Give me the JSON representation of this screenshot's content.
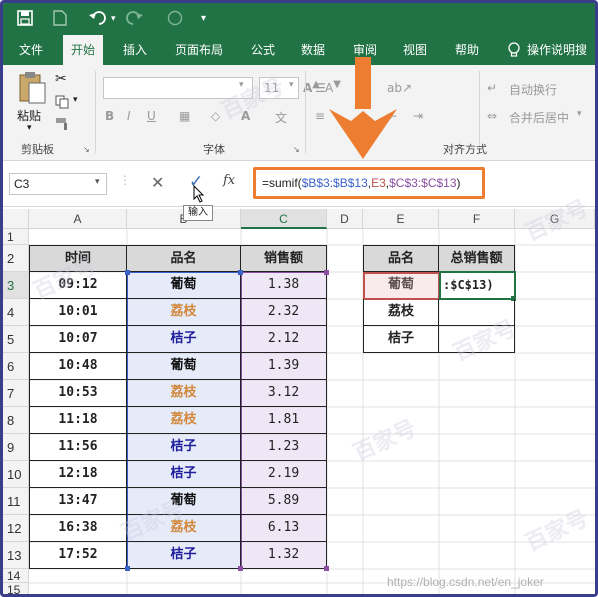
{
  "qat": {
    "save_icon": "save-icon",
    "new_icon": "new-file-icon",
    "undo_icon": "undo-icon",
    "redo_icon": "redo-icon",
    "more_icon": "customize-qat-icon"
  },
  "tabs": [
    {
      "label": "文件"
    },
    {
      "label": "开始"
    },
    {
      "label": "插入"
    },
    {
      "label": "页面布局"
    },
    {
      "label": "公式"
    },
    {
      "label": "数据"
    },
    {
      "label": "审阅"
    },
    {
      "label": "视图"
    },
    {
      "label": "帮助"
    },
    {
      "label": "操作说明搜"
    }
  ],
  "ribbon": {
    "paste_label": "粘贴",
    "clipboard_label": "剪贴板",
    "font_label": "字体",
    "font_size": "11",
    "alignment_label": "对齐方式",
    "wrap_text": "自动换行",
    "merge_center": "合并后居中"
  },
  "formula_bar": {
    "name_box": "C3",
    "cancel": "✕",
    "enter": "✓",
    "fx": "fx",
    "formula_prefix": "=sumif(",
    "formula_range1": "$B$3:$B$13",
    "formula_comma1": ",",
    "formula_crit": "E3",
    "formula_comma2": ",",
    "formula_range2": "$C$3:$C$13",
    "formula_suffix": ")",
    "enter_tooltip": "输入"
  },
  "columns": [
    "A",
    "B",
    "C",
    "D",
    "E",
    "F",
    "G"
  ],
  "rows": [
    "1",
    "2",
    "3",
    "4",
    "5",
    "6",
    "7",
    "8",
    "9",
    "10",
    "11",
    "12",
    "13",
    "14",
    "15"
  ],
  "table": {
    "headers": [
      "时间",
      "品名",
      "销售额"
    ],
    "rows": [
      [
        "09:12",
        "葡萄",
        "1.38"
      ],
      [
        "10:01",
        "荔枝",
        "2.32"
      ],
      [
        "10:07",
        "桔子",
        "2.12"
      ],
      [
        "10:48",
        "葡萄",
        "1.39"
      ],
      [
        "10:53",
        "荔枝",
        "3.12"
      ],
      [
        "11:18",
        "荔枝",
        "1.81"
      ],
      [
        "11:56",
        "桔子",
        "1.23"
      ],
      [
        "12:18",
        "桔子",
        "2.19"
      ],
      [
        "13:47",
        "葡萄",
        "5.89"
      ],
      [
        "16:38",
        "荔枝",
        "6.13"
      ],
      [
        "17:52",
        "桔子",
        "1.32"
      ]
    ]
  },
  "summary": {
    "headers": [
      "品名",
      "总销售额"
    ],
    "rows": [
      [
        "葡萄",
        ":$C$13)"
      ],
      [
        "荔枝",
        ""
      ],
      [
        "桔子",
        ""
      ]
    ]
  },
  "watermark": "百家号",
  "url": "https://blog.csdn.net/en_joker",
  "colors": {
    "excel_green": "#217346",
    "arrow_orange": "#ed7d31",
    "grape": "#111111",
    "lychee": "#d2873a",
    "orange": "#1f1f9c"
  }
}
